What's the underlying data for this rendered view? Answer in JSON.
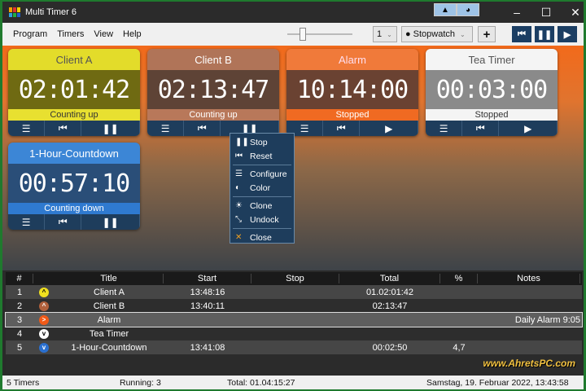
{
  "app": {
    "title": "Multi Timer 6"
  },
  "menu": [
    "Program",
    "Timers",
    "View",
    "Help"
  ],
  "toolbar": {
    "count": "1",
    "mode": "Stopwatch",
    "add": "+"
  },
  "cards": [
    {
      "title": "Client A",
      "time": "02:01:42",
      "status": "Counting up",
      "hd": "#e3dc2a",
      "hdtext": "#555",
      "dg": "#6f6a12",
      "st": "#e8e030",
      "sttext": "#333",
      "pp": "❚❚"
    },
    {
      "title": "Client B",
      "time": "02:13:47",
      "status": "Counting up",
      "hd": "#b07458",
      "hdtext": "#fff",
      "dg": "#5e4336",
      "st": "#b8785a",
      "sttext": "#fff",
      "pp": "❚❚"
    },
    {
      "title": "Alarm",
      "time": "10:14:00",
      "status": "Stopped",
      "hd": "#f07a3a",
      "hdtext": "#fde",
      "dg": "#6a4232",
      "st": "#f06a22",
      "sttext": "#fff",
      "pp": "▶"
    },
    {
      "title": "Tea Timer",
      "time": "00:03:00",
      "status": "Stopped",
      "hd": "#f4f4f4",
      "hdtext": "#555",
      "dg": "#8a8a8a",
      "st": "#f4f4f4",
      "sttext": "#333",
      "pp": "▶"
    },
    {
      "title": "1-Hour-Countdown",
      "time": "00:57:10",
      "status": "Counting down",
      "hd": "#3c86d6",
      "hdtext": "#fff",
      "dg": "#2a4e78",
      "st": "#2f7ad0",
      "sttext": "#fff",
      "pp": "❚❚"
    }
  ],
  "context_menu": [
    {
      "icon": "❚❚",
      "label": "Stop"
    },
    {
      "icon": "⏮",
      "label": "Reset"
    },
    {
      "icon": "☰",
      "label": "Configure"
    },
    {
      "icon": "◐",
      "label": "Color"
    },
    {
      "icon": "☀",
      "label": "Clone"
    },
    {
      "icon": "⤡",
      "label": "Undock"
    },
    {
      "icon": "✕",
      "label": "Close"
    }
  ],
  "table": {
    "headers": [
      "#",
      "",
      "Title",
      "Start",
      "Stop",
      "Total",
      "%",
      "Notes"
    ],
    "rows": [
      {
        "n": "1",
        "icon": "^",
        "color": "#f0e020",
        "title": "Client A",
        "start": "13:48:16",
        "stop": "",
        "total": "01.02:01:42",
        "pct": "",
        "notes": ""
      },
      {
        "n": "2",
        "icon": "^",
        "color": "#b0603c",
        "title": "Client B",
        "start": "13:40:11",
        "stop": "",
        "total": "02:13:47",
        "pct": "",
        "notes": ""
      },
      {
        "n": "3",
        "icon": ">",
        "color": "#f05a18",
        "title": "Alarm",
        "start": "",
        "stop": "",
        "total": "",
        "pct": "",
        "notes": "Daily Alarm 9:05"
      },
      {
        "n": "4",
        "icon": "v",
        "color": "#ffffff",
        "title": "Tea Timer",
        "start": "",
        "stop": "",
        "total": "",
        "pct": "",
        "notes": ""
      },
      {
        "n": "5",
        "icon": "v",
        "color": "#2a70d0",
        "title": "1-Hour-Countdown",
        "start": "13:41:08",
        "stop": "",
        "total": "00:02:50",
        "pct": "4,7",
        "notes": ""
      }
    ]
  },
  "watermark": "www.AhretsPC.com",
  "status": {
    "timers": "5 Timers",
    "running": "Running: 3",
    "total": "Total: 01.04:15:27",
    "date": "Samstag, 19. Februar 2022, 13:43:58"
  }
}
